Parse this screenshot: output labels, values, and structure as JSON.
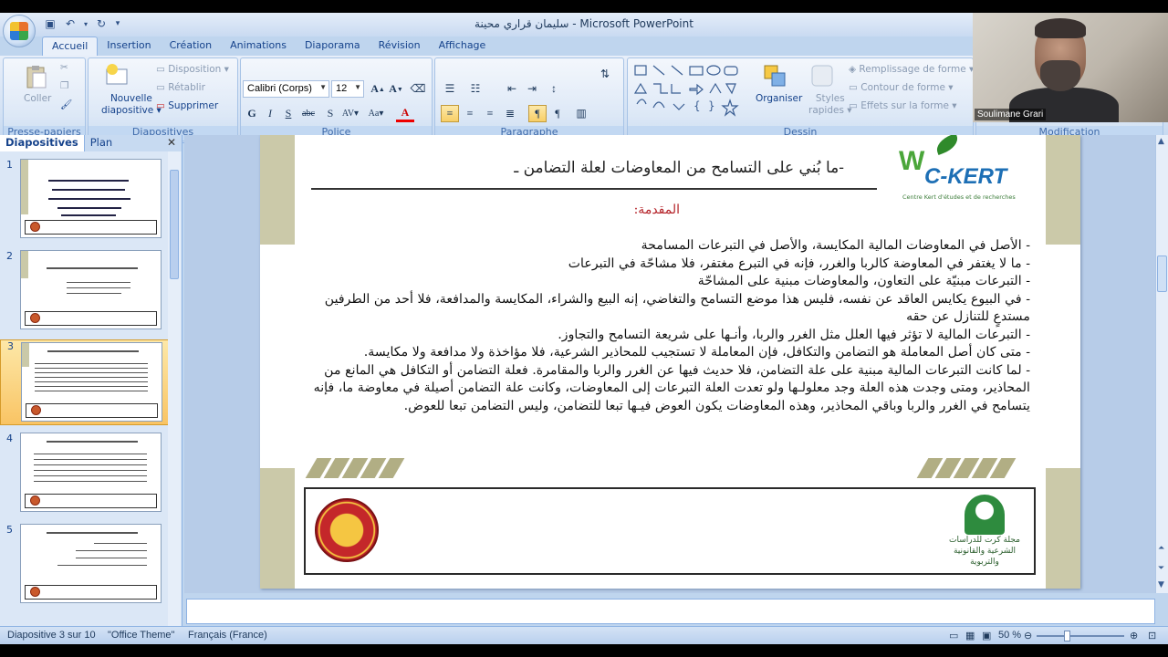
{
  "window": {
    "title": "سليمان قراري محينة - Microsoft PowerPoint"
  },
  "tabs": [
    "Accueil",
    "Insertion",
    "Création",
    "Animations",
    "Diaporama",
    "Révision",
    "Affichage"
  ],
  "ribbon": {
    "presse_papiers": {
      "label": "Presse-papiers",
      "coller": "Coller"
    },
    "diapositives": {
      "label": "Diapositives",
      "nouvelle": "Nouvelle",
      "diapositive": "diapositive",
      "disposition": "Disposition",
      "retablir": "Rétablir",
      "supprimer": "Supprimer"
    },
    "police": {
      "label": "Police",
      "font": "Calibri (Corps)",
      "size": "12"
    },
    "paragraphe": {
      "label": "Paragraphe"
    },
    "dessin": {
      "label": "Dessin",
      "organiser": "Organiser",
      "styles": "Styles",
      "rapides": "rapides",
      "remplissage": "Remplissage de forme",
      "contour": "Contour de forme",
      "effets": "Effets sur la forme"
    },
    "modification": {
      "label": "Modification"
    }
  },
  "webcam": {
    "name": "Soulimane Grari"
  },
  "left_panel": {
    "tab_diapositives": "Diapositives",
    "tab_plan": "Plan",
    "slides": [
      {
        "num": "1"
      },
      {
        "num": "2"
      },
      {
        "num": "3"
      },
      {
        "num": "4"
      },
      {
        "num": "5"
      }
    ]
  },
  "slide": {
    "logo_main": "C-KERT",
    "logo_sub": "Centre Kert d'études et de recherches",
    "title": "-ما بُني على التسامح من المعاوضات لعلة التضامن ـ",
    "intro": "المقدمة:",
    "lines": [
      "- الأصل في المعاوضات المالية المكايسة، والأصل في التبرعات المسامحة",
      "- ما لا يغتفر في المعاوضة كالربا والغرر، فإنه في التبرع مغتفر، فلا مشاحّة في التبرعات",
      "- التبرعات مبنيّة على التعاون، والمعاوضات مبنية على المشاحّة",
      "- في البيوع يكايس العاقد عن نفسه، فليس هذا موضع التسامح والتغاضي، إنه البيع والشراء، المكايسة والمدافعة، فلا أحد من الطرفين مستدعٍ للتنازل عن حقه",
      "- التبرعات المالية لا تؤثر فيها العلل مثل الغرر والربا، وأنـها على شريعة التسامح والتجاوز.",
      "- متى كان أصل المعاملة هو التضامن والتكافل، فإن المعاملة لا تستجيب للمحاذير الشرعية، فلا مؤاخذة ولا مدافعة ولا مكايسة.",
      "- لما كانت التبرعات المالية مبنية على علة التضامن، فلا حديث فيها عن الغرر والربا والمقامرة. فعلة التضامن أو التكافل هي المانع من المحاذير، ومتى وجدت هذه العلة وجد معلولـها ولو تعدت العلة التبرعات إلى المعاوضات، وكانت علة التضامن أصيلة في معاوضة ما، فإنه يتسامح في الغرر والربا وباقي المحاذير، وهذه المعاوضات يكون العوض فيـها تبعا للتضامن، وليس التضامن تبعا للعوض."
    ],
    "footer_logo_text": "مجلة كرت للدراسات الشرعية والقانونية والتربوية"
  },
  "status": {
    "slide_info": "Diapositive 3 sur 10",
    "theme": "\"Office Theme\"",
    "language": "Français (France)",
    "zoom": "50 %",
    "zoom_fraction": 0.35
  },
  "colors": {
    "accent": "#15428b",
    "intro_red": "#b5242a",
    "slide_sidebar": "#cbc9a9",
    "selected_thumb": "#f9c464"
  }
}
